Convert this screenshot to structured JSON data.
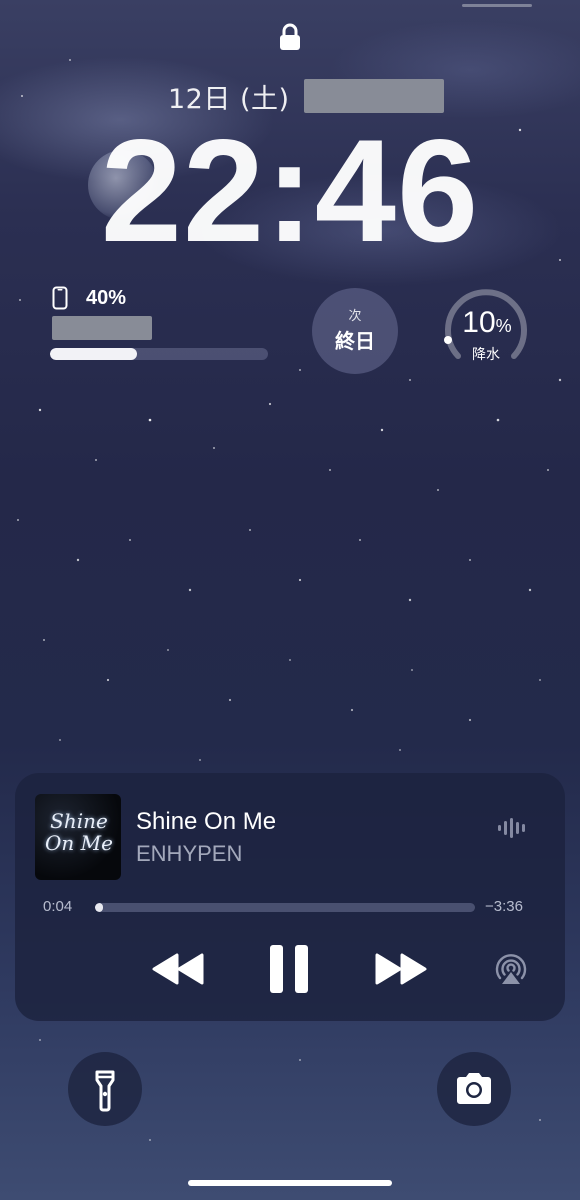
{
  "lock_screen": {
    "date": "12日 (土)",
    "time": "22:46"
  },
  "widgets": {
    "battery": {
      "percent_label": "40%",
      "level": 0.4
    },
    "next_event": {
      "small_label": "次",
      "main_label": "終日"
    },
    "precipitation": {
      "value": "10",
      "unit": "%",
      "label": "降水",
      "level": 0.1
    }
  },
  "now_playing": {
    "artwork_text_line1": "Shine",
    "artwork_text_line2": "On Me",
    "title": "Shine On Me",
    "artist": "ENHYPEN",
    "elapsed": "0:04",
    "remaining": "−3:36",
    "progress": 0.02
  },
  "icons": {
    "lock": "lock-icon",
    "battery_device": "iphone-icon",
    "audio_wave": "waveform-icon",
    "rewind": "rewind-icon",
    "pause": "pause-icon",
    "forward": "fast-forward-icon",
    "airplay": "airplay-icon",
    "flashlight": "flashlight-icon",
    "camera": "camera-icon"
  },
  "colors": {
    "background_top": "#3a3f63",
    "background_bottom": "#3e4c72",
    "player_bg": "#1c223e",
    "accent_white": "#ffffff"
  }
}
